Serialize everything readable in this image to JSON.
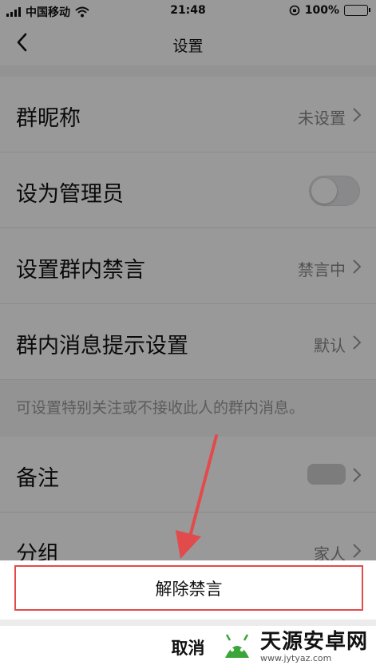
{
  "status_bar": {
    "carrier": "中国移动",
    "time": "21:48",
    "battery": "100%"
  },
  "nav": {
    "title": "设置"
  },
  "rows": [
    {
      "label": "群昵称",
      "value": "未设置"
    },
    {
      "label": "设为管理员"
    },
    {
      "label": "设置群内禁言",
      "value": "禁言中"
    },
    {
      "label": "群内消息提示设置",
      "value": "默认"
    }
  ],
  "hint": "可设置特别关注或不接收此人的群内消息。",
  "rows2": [
    {
      "label": "备注"
    },
    {
      "label": "分组",
      "value": "家人"
    }
  ],
  "sheet": {
    "action_label": "解除禁言",
    "cancel_label": "取消"
  },
  "watermark": {
    "brand": "天源安卓网",
    "url": "www.jytyaz.com"
  },
  "colors": {
    "highlight": "#e24b4b",
    "watermark_green": "#3aa63a"
  }
}
